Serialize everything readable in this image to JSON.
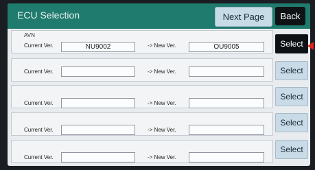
{
  "header": {
    "title": "ECU Selection",
    "next_page_label": "Next Page",
    "back_label": "Back"
  },
  "labels": {
    "current_ver": "Current Ver.",
    "new_ver": "-> New Ver.",
    "select": "Select"
  },
  "rows": [
    {
      "name": "AVN",
      "current_ver": "NU9002",
      "new_ver": "OU9005"
    },
    {
      "name": "",
      "current_ver": "",
      "new_ver": ""
    },
    {
      "name": "",
      "current_ver": "",
      "new_ver": ""
    },
    {
      "name": "",
      "current_ver": "",
      "new_ver": ""
    },
    {
      "name": "",
      "current_ver": "",
      "new_ver": ""
    }
  ],
  "colors": {
    "header_bg": "#1f7b6d",
    "selected_button": "#0e1114",
    "pointer_arrow": "#e0251b"
  }
}
